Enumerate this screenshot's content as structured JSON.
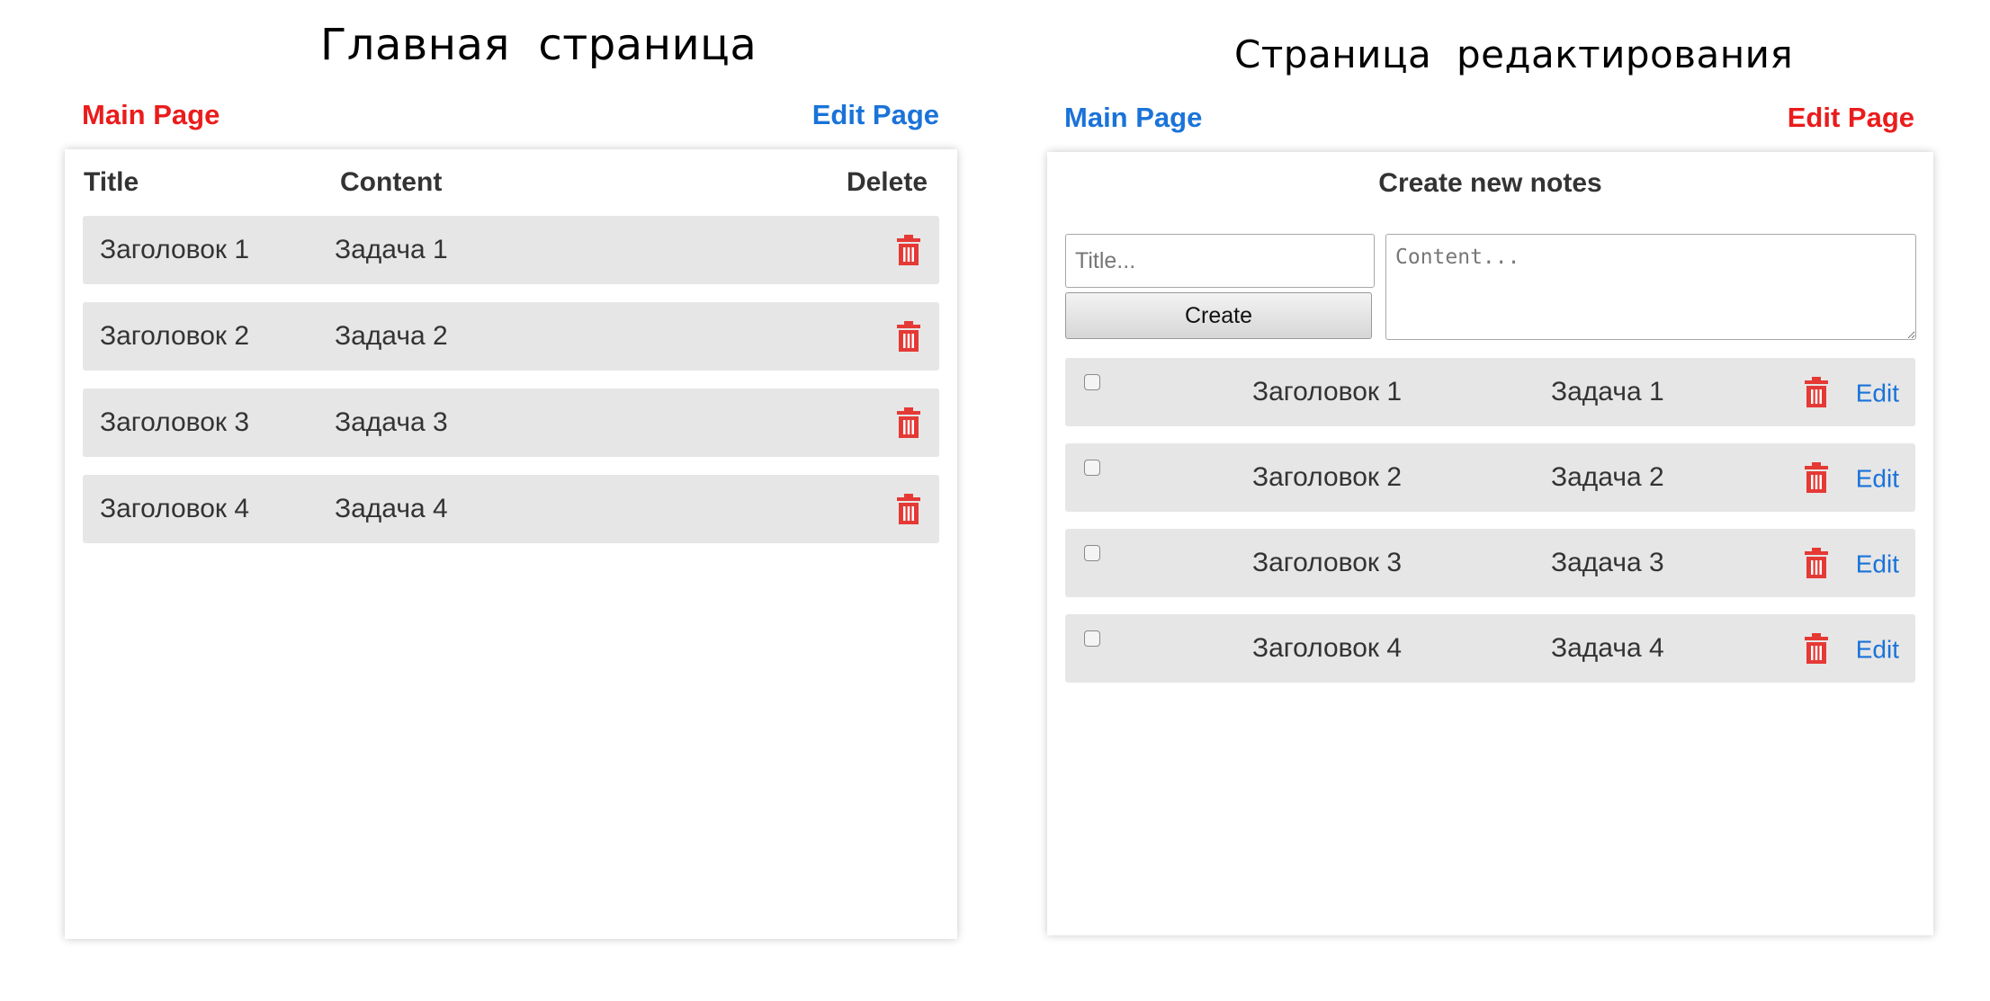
{
  "headings": {
    "main": "Главная  страница",
    "edit": "Страница  редактирования"
  },
  "nav": {
    "main_page": "Main Page",
    "edit_page": "Edit Page"
  },
  "colors": {
    "active_nav": "#ea1c1c",
    "inactive_nav": "#1a73d9",
    "trash": "#e53935",
    "row_bg": "#e6e6e6"
  },
  "main_table": {
    "headers": {
      "title": "Title",
      "content": "Content",
      "delete": "Delete"
    },
    "rows": [
      {
        "title": "Заголовок 1",
        "content": "Задача 1",
        "delete_icon": "trash-icon"
      },
      {
        "title": "Заголовок 2",
        "content": "Задача 2",
        "delete_icon": "trash-icon"
      },
      {
        "title": "Заголовок 3",
        "content": "Задача 3",
        "delete_icon": "trash-icon"
      },
      {
        "title": "Заголовок 4",
        "content": "Задача 4",
        "delete_icon": "trash-icon"
      }
    ]
  },
  "edit_page": {
    "form_title": "Create new notes",
    "title_placeholder": "Title...",
    "content_placeholder": "Content...",
    "create_label": "Create",
    "edit_label": "Edit",
    "rows": [
      {
        "checked": false,
        "title": "Заголовок 1",
        "content": "Задача 1"
      },
      {
        "checked": false,
        "title": "Заголовок 2",
        "content": "Задача 2"
      },
      {
        "checked": false,
        "title": "Заголовок 3",
        "content": "Задача 3"
      },
      {
        "checked": false,
        "title": "Заголовок 4",
        "content": "Задача 4"
      }
    ]
  }
}
